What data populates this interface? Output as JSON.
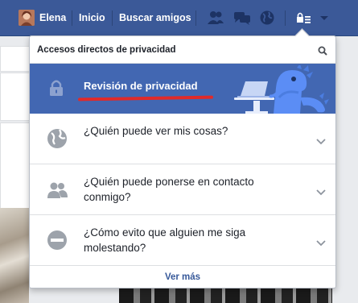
{
  "topbar": {
    "user_name": "Elena",
    "home_label": "Inicio",
    "find_friends_label": "Buscar amigos",
    "icons": [
      "friend-requests-icon",
      "messages-icon",
      "notifications-globe-icon",
      "privacy-shortcuts-icon",
      "account-menu-chevron-icon"
    ]
  },
  "dropdown": {
    "title": "Accesos directos de privacidad",
    "search_icon": "search-icon",
    "banner": {
      "label": "Revisión de privacidad",
      "icon": "lock-icon",
      "illustration": "dinosaur-mascot-laptop"
    },
    "options": [
      {
        "label": "¿Quién puede ver mis cosas?",
        "icon": "globe-icon"
      },
      {
        "label": "¿Quién puede ponerse en contacto conmigo?",
        "icon": "people-icon"
      },
      {
        "label": "¿Cómo evito que alguien me siga molestando?",
        "icon": "block-icon"
      }
    ],
    "see_more": "Ver más"
  },
  "colors": {
    "brand_blue": "#3b5998",
    "banner_blue": "#4267b2",
    "link_blue": "#365899",
    "annotation_red": "#e02a2a"
  }
}
